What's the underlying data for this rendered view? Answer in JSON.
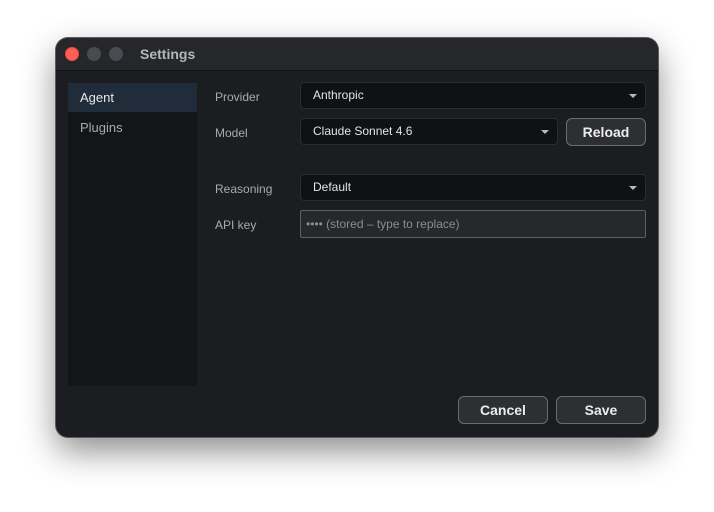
{
  "window": {
    "title": "Settings"
  },
  "sidebar": {
    "items": [
      {
        "label": "Agent",
        "active": true
      },
      {
        "label": "Plugins",
        "active": false
      }
    ]
  },
  "form": {
    "provider": {
      "label": "Provider",
      "value": "Anthropic"
    },
    "model": {
      "label": "Model",
      "value": "Claude Sonnet 4.6",
      "reload_label": "Reload"
    },
    "reasoning": {
      "label": "Reasoning",
      "value": "Default"
    },
    "api_key": {
      "label": "API key",
      "placeholder": "•••• (stored – type to replace)"
    }
  },
  "footer": {
    "cancel_label": "Cancel",
    "save_label": "Save"
  },
  "colors": {
    "window_bg": "#1c1d20",
    "titlebar_bg": "#26272b",
    "sidebar_bg": "#141518",
    "sidebar_active_bg": "#202c3a",
    "close_button": "#ff5f57"
  },
  "icons": {
    "select_arrow": "chevron-down-icon"
  }
}
